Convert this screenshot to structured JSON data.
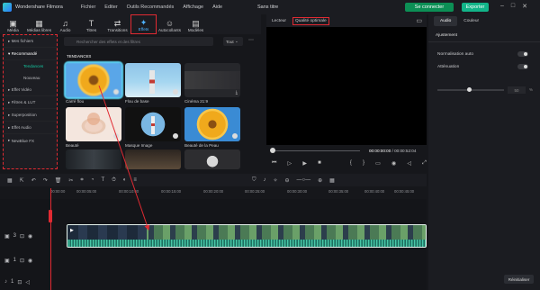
{
  "titlebar": {
    "app_name": "Wondershare Filmora",
    "menu": [
      "Fichier",
      "Editer",
      "Outils Recommandés",
      "Affichage",
      "Aide"
    ],
    "doc_title": "Sans titre",
    "connect": "Se connecter",
    "export": "Exporter"
  },
  "toolbar": {
    "tabs": [
      {
        "label": "Média",
        "icon": "media-icon"
      },
      {
        "label": "Médias libres",
        "icon": "stock-media-icon"
      },
      {
        "label": "Audio",
        "icon": "music-icon"
      },
      {
        "label": "Titres",
        "icon": "titles-icon"
      },
      {
        "label": "Transitions",
        "icon": "transitions-icon"
      },
      {
        "label": "Effets",
        "icon": "effects-icon"
      },
      {
        "label": "Autocollants",
        "icon": "stickers-icon"
      },
      {
        "label": "Modèles",
        "icon": "templates-icon"
      }
    ],
    "active": "Effets"
  },
  "left_panel": {
    "items": [
      {
        "label": "Mes fichiers"
      },
      {
        "label": "Recommandé"
      },
      {
        "label": "Tendances",
        "sub": true
      },
      {
        "label": "Nouveau",
        "sub": true
      },
      {
        "label": "Effet Vidéo"
      },
      {
        "label": "Filtres & LUT"
      },
      {
        "label": "Superposition"
      },
      {
        "label": "Effet Audio"
      },
      {
        "label": "NewBlue FX"
      }
    ]
  },
  "effects": {
    "search_placeholder": "Rechercher des effets et des filtres",
    "filter": "Tout",
    "section": "TENDANCES",
    "cards": [
      {
        "label": "Carré flou"
      },
      {
        "label": "Flou de base"
      },
      {
        "label": "Cinéma 21:9"
      },
      {
        "label": "Beauté"
      },
      {
        "label": "Masque Image"
      },
      {
        "label": "Beauté de la Peau"
      },
      {
        "label": ""
      },
      {
        "label": ""
      },
      {
        "label": ""
      }
    ]
  },
  "preview": {
    "player": "Lecteur",
    "quality": "Qualité optimale",
    "time_current": "00:00:00:00",
    "time_total": "/ 00:00:52:04"
  },
  "right_panel": {
    "tabs": [
      "Audio",
      "Couleur"
    ],
    "section": "Ajustement",
    "normalize": "Normalisation auto",
    "attenuation": "Atténuation",
    "attenuation_value": "50",
    "attenuation_unit": "%",
    "reset": "Réinitialiser"
  },
  "timeline": {
    "ruler": [
      "00:00:00",
      "00:00:05:00",
      "00:00:10:00",
      "00:00:15:00",
      "00:00:20:00",
      "00:00:25:00",
      "00:00:30:00",
      "00:00:35:00",
      "00:00:40:00",
      "00:00:45:00",
      "00:00:50:00"
    ],
    "tracks": [
      {
        "num": "3",
        "icon": "video-track-icon"
      },
      {
        "num": "1",
        "icon": "video-track-icon"
      },
      {
        "num": "1",
        "icon": "audio-track-icon"
      }
    ]
  },
  "colors": {
    "accent": "#12b489",
    "highlight_border": "#e12a32",
    "active_tab": "#4fb3ff"
  }
}
